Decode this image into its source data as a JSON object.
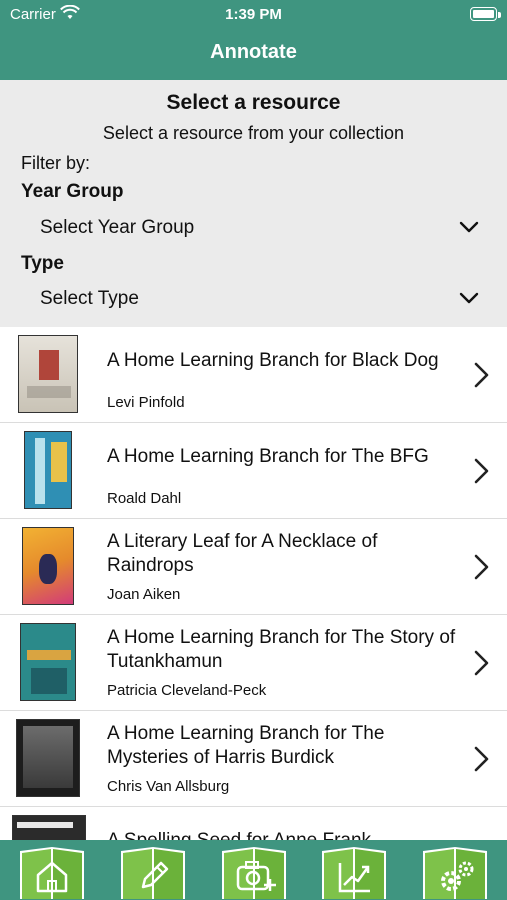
{
  "status": {
    "carrier": "Carrier",
    "time": "1:39 PM"
  },
  "nav": {
    "title": "Annotate"
  },
  "filters": {
    "heading": "Select a resource",
    "subheading": "Select a resource from your collection",
    "filter_by": "Filter by:",
    "year_group_label": "Year Group",
    "year_group_value": "Select Year Group",
    "type_label": "Type",
    "type_value": "Select Type"
  },
  "resources": [
    {
      "title": "A Home Learning Branch for Black Dog",
      "author": "Levi Pinfold",
      "cover_color": "#c9c3b6",
      "accent": "#b0453a"
    },
    {
      "title": "A Home Learning Branch for The BFG",
      "author": "Roald Dahl",
      "cover_color": "#2f8fb4",
      "accent": "#e8c24a"
    },
    {
      "title": "A Literary Leaf for A Necklace of Raindrops",
      "author": "Joan Aiken",
      "cover_color": "#e58a2c",
      "accent": "#d23b7a"
    },
    {
      "title": "A Home Learning Branch for The Story of Tutankhamun",
      "author": "Patricia Cleveland-Peck",
      "cover_color": "#2b8a8a",
      "accent": "#d9a441"
    },
    {
      "title": "A Home Learning Branch for The Mysteries of Harris Burdick",
      "author": "Chris Van Allsburg",
      "cover_color": "#3a3a3a",
      "accent": "#8a8a8a"
    },
    {
      "title": "A Spelling Seed for Anne Frank",
      "author": "",
      "cover_color": "#2b2b2b",
      "accent": "#ffffff"
    }
  ],
  "tabs": [
    {
      "name": "home",
      "icon": "home-icon"
    },
    {
      "name": "annotate",
      "icon": "pencil-icon"
    },
    {
      "name": "camera",
      "icon": "camera-add-icon"
    },
    {
      "name": "progress",
      "icon": "chart-icon"
    },
    {
      "name": "settings",
      "icon": "gear-icon"
    }
  ],
  "colors": {
    "brand": "#3f9580",
    "tab_icon_green": "#7ec24a",
    "filter_bg": "#ebebeb"
  }
}
